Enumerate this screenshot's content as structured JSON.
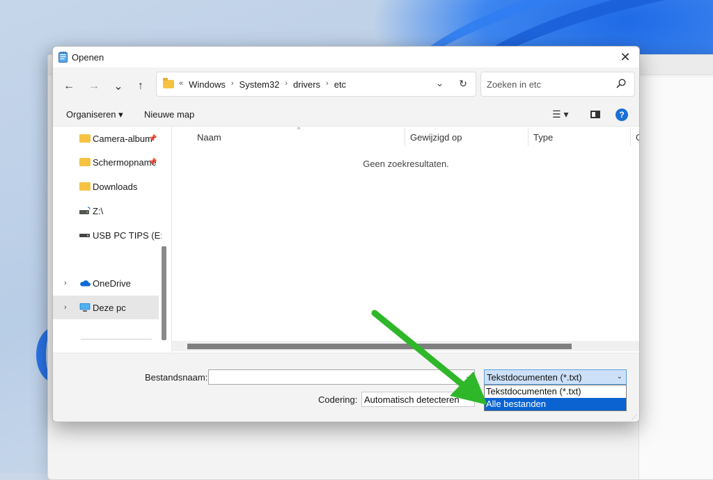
{
  "dialog": {
    "title": "Openen",
    "close_label": "✕"
  },
  "nav": {
    "back": "←",
    "forward": "→",
    "recent": "⌄",
    "up": "↑"
  },
  "address": {
    "overflow": "«",
    "crumbs": [
      "Windows",
      "System32",
      "drivers",
      "etc"
    ],
    "separator": "›"
  },
  "search": {
    "placeholder": "Zoeken in etc"
  },
  "toolbar": {
    "organize_label": "Organiseren ▾",
    "new_folder_label": "Nieuwe map",
    "view_label": "☰ ▾",
    "help_label": "?"
  },
  "sidebar": {
    "items": [
      {
        "label": "Camera-album",
        "icon": "folder-icon",
        "pinned": true
      },
      {
        "label": "Schermopnamen",
        "icon": "folder-icon",
        "pinned": true
      },
      {
        "label": "Downloads",
        "icon": "download-folder-icon",
        "pinned": false
      },
      {
        "label": "Z:\\",
        "icon": "network-drive-icon",
        "pinned": false
      },
      {
        "label": "USB PC TIPS (E:)",
        "icon": "usb-drive-icon",
        "pinned": false
      },
      {
        "label": "OneDrive",
        "icon": "onedrive-icon",
        "expandable": true
      },
      {
        "label": "Deze pc",
        "icon": "this-pc-icon",
        "expandable": true,
        "selected": true
      }
    ],
    "pin_glyph": "📌",
    "expand_glyph": "›"
  },
  "list": {
    "columns": [
      "Naam",
      "Gewijzigd op",
      "Type",
      "G"
    ],
    "sort_glyph": "^",
    "empty_message": "Geen zoekresultaten."
  },
  "footer": {
    "filename_label": "Bestandsnaam:",
    "filename_value": "",
    "filetype_selected": "Tekstdocumenten (*.txt)",
    "filetype_options": [
      "Tekstdocumenten (*.txt)",
      "Alle bestanden"
    ],
    "highlighted_option": 1,
    "encoding_label": "Codering:",
    "encoding_value": "Automatisch detecteren"
  },
  "colors": {
    "accent": "#0b63d1",
    "arrow": "#2fb72a",
    "folder": "#f5c242"
  }
}
